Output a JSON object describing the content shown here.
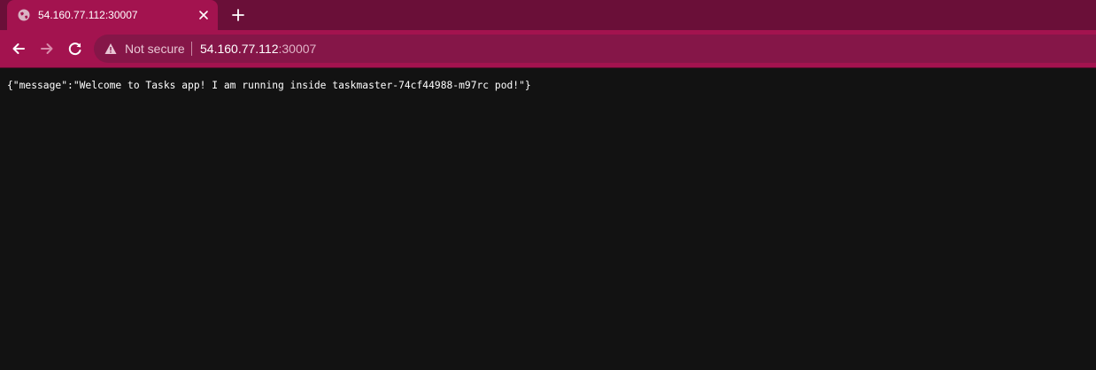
{
  "browser": {
    "tab": {
      "title": "54.160.77.112:30007",
      "favicon_icon": "globe-icon",
      "close_icon": "close-icon"
    },
    "new_tab_icon": "plus-icon",
    "toolbar": {
      "back_icon": "arrow-left-icon",
      "forward_icon": "arrow-right-icon",
      "reload_icon": "reload-icon"
    },
    "omnibox": {
      "security_icon": "warning-icon",
      "security_label": "Not secure",
      "url_host": "54.160.77.112",
      "url_port": ":30007"
    },
    "colors": {
      "tab_strip": "#6a0f38",
      "toolbar": "#a3134f",
      "omnibox": "#851648",
      "page_background": "#121212"
    }
  },
  "page": {
    "body_text": "{\"message\":\"Welcome to Tasks app! I am running inside taskmaster-74cf44988-m97rc pod!\"}"
  }
}
